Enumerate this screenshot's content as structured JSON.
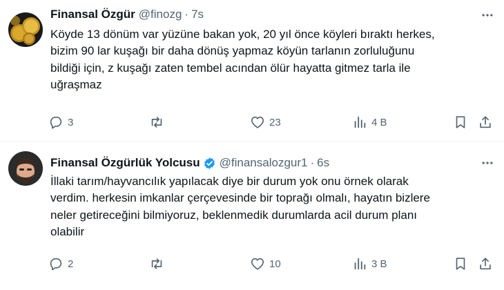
{
  "tweets": [
    {
      "name": "Finansal Özgür",
      "handle": "@finozg",
      "dot": "·",
      "time": "7s",
      "verified": false,
      "lines": [
        "Köyde 13 dönüm var yüzüne bakan yok, 20 yıl önce köyleri bıraktı herkes,",
        "bizim 90 lar kuşağı bir daha dönüş yapmaz köyün tarlanın zorluluğunu",
        "bildiği için, z kuşağı zaten tembel acından ölür  hayatta gitmez tarla ile",
        "uğraşmaz"
      ],
      "replies": "3",
      "retweets": "",
      "likes": "23",
      "views": "4 B"
    },
    {
      "name": "Finansal Özgürlük Yolcusu",
      "handle": "@finansalozgur1",
      "dot": "·",
      "time": "6s",
      "verified": true,
      "lines": [
        "İllaki tarım/hayvancılık yapılacak diye bir durum yok onu örnek olarak",
        "verdim. herkesin imkanlar çerçevesinde bir toprağı olmalı, hayatın bizlere",
        "neler getireceğini bilmiyoruz, beklenmedik durumlarda acil durum planı",
        "olabilir"
      ],
      "replies": "2",
      "retweets": "",
      "likes": "10",
      "views": "3 B"
    }
  ],
  "colors": {
    "text": "#0f1419",
    "secondary": "#536471",
    "verified": "#1d9bf0",
    "divider": "#eff3f4"
  },
  "icons": [
    "more-icon",
    "reply-icon",
    "retweet-icon",
    "like-icon",
    "views-icon",
    "bookmark-icon",
    "share-icon",
    "verified-badge-icon"
  ]
}
